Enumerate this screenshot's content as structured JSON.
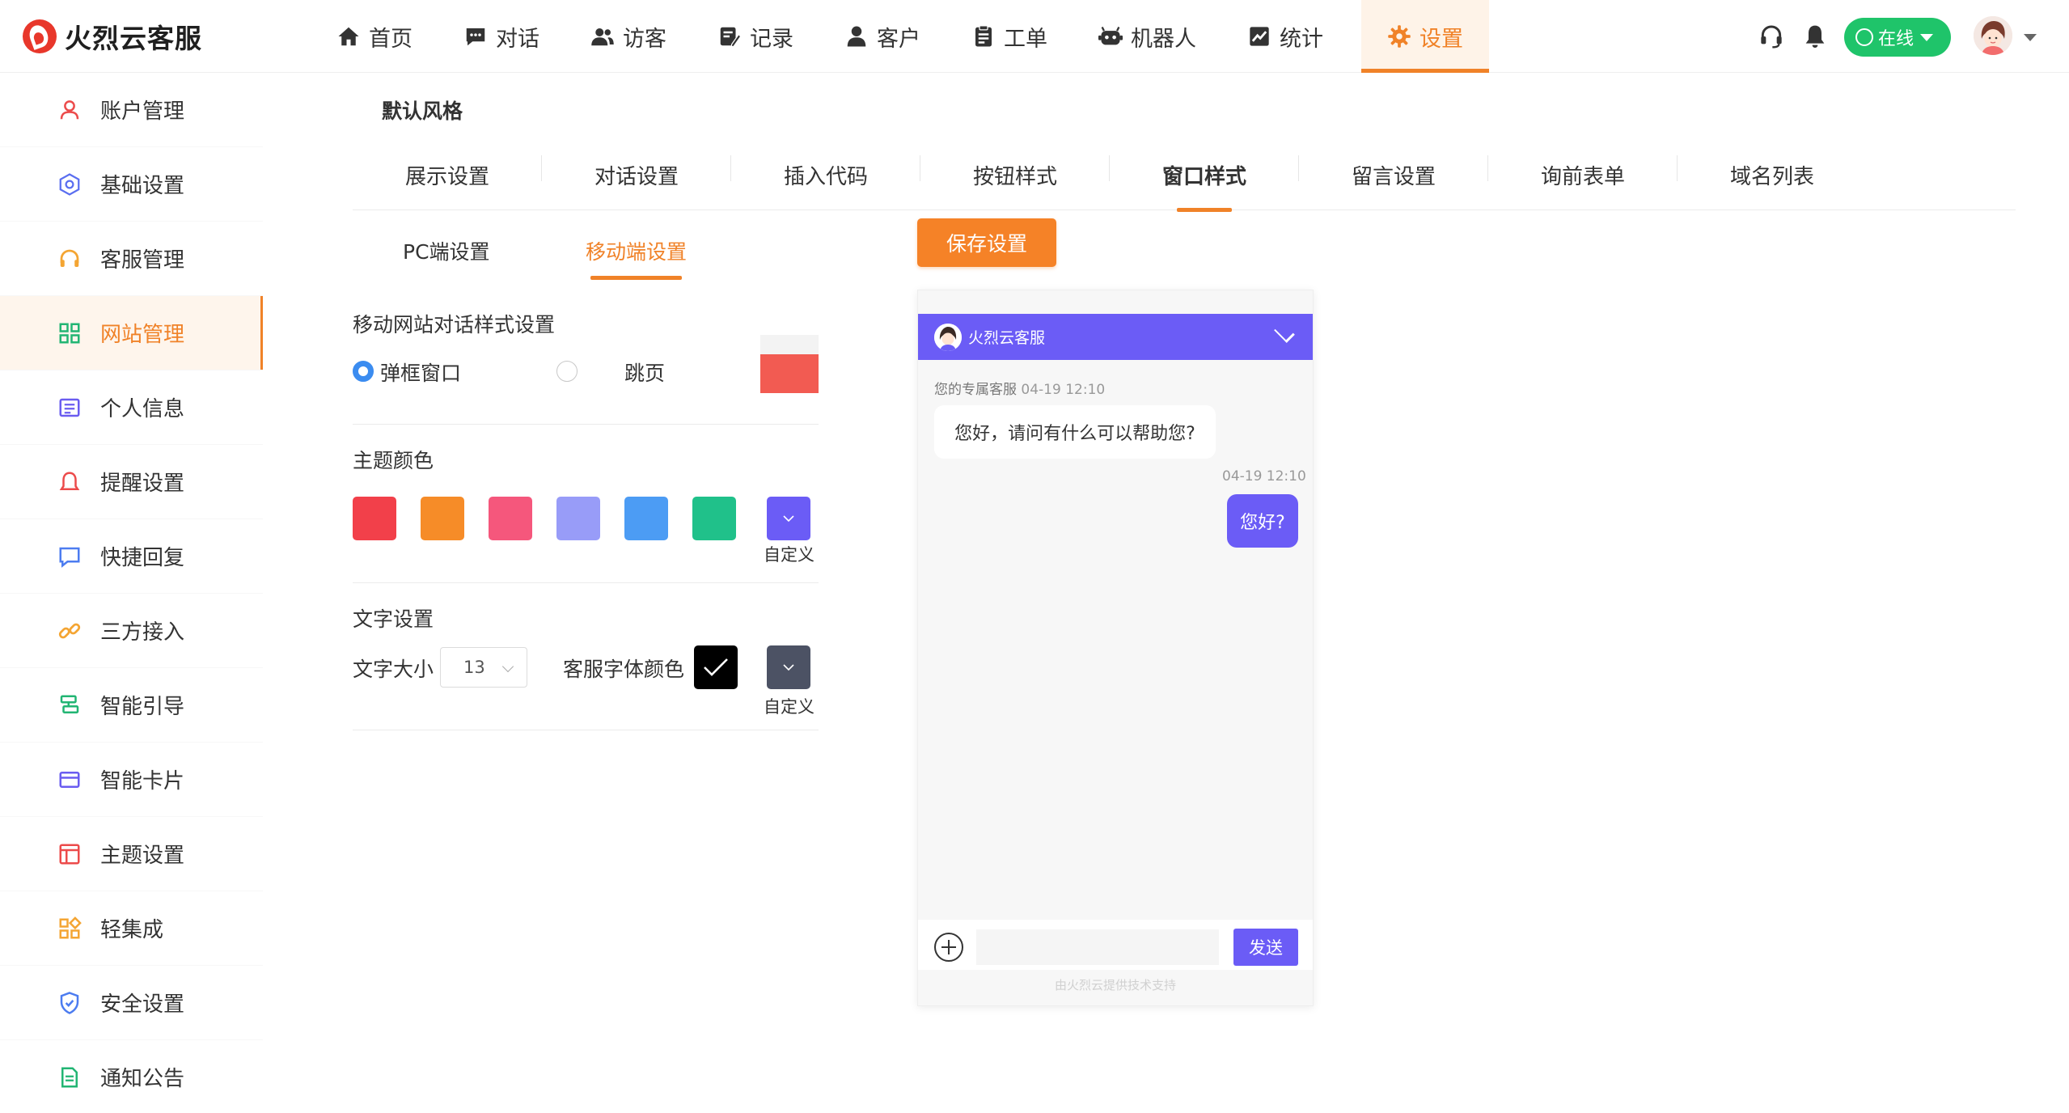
{
  "brand": {
    "name": "火烈云客服",
    "color": "#e8372b"
  },
  "nav": {
    "items": [
      {
        "label": "首页",
        "icon": "home-icon"
      },
      {
        "label": "对话",
        "icon": "chat-icon"
      },
      {
        "label": "访客",
        "icon": "visitors-icon"
      },
      {
        "label": "记录",
        "icon": "record-icon"
      },
      {
        "label": "客户",
        "icon": "customer-icon"
      },
      {
        "label": "工单",
        "icon": "ticket-icon"
      },
      {
        "label": "机器人",
        "icon": "robot-icon"
      },
      {
        "label": "统计",
        "icon": "stats-icon"
      },
      {
        "label": "设置",
        "icon": "gear-icon",
        "active": true
      }
    ],
    "accent": "#f08228"
  },
  "status": {
    "label": "在线",
    "color": "#1fc46a"
  },
  "sidebar": {
    "items": [
      {
        "label": "账户管理",
        "icon": "user-icon"
      },
      {
        "label": "基础设置",
        "icon": "hexagon-icon"
      },
      {
        "label": "客服管理",
        "icon": "headset-icon"
      },
      {
        "label": "网站管理",
        "icon": "grid-icon",
        "active": true
      },
      {
        "label": "个人信息",
        "icon": "profile-card-icon"
      },
      {
        "label": "提醒设置",
        "icon": "bell-icon"
      },
      {
        "label": "快捷回复",
        "icon": "message-icon"
      },
      {
        "label": "三方接入",
        "icon": "link-icon"
      },
      {
        "label": "智能引导",
        "icon": "guide-icon"
      },
      {
        "label": "智能卡片",
        "icon": "card-icon"
      },
      {
        "label": "主题设置",
        "icon": "theme-icon"
      },
      {
        "label": "轻集成",
        "icon": "integration-icon"
      },
      {
        "label": "安全设置",
        "icon": "shield-icon"
      },
      {
        "label": "通知公告",
        "icon": "notice-icon"
      }
    ]
  },
  "page": {
    "section_title": "默认风格",
    "tabs": [
      "展示设置",
      "对话设置",
      "插入代码",
      "按钮样式",
      "窗口样式",
      "留言设置",
      "询前表单",
      "域名列表"
    ],
    "active_tab": "窗口样式",
    "subtabs": [
      "PC端设置",
      "移动端设置"
    ],
    "active_subtab": "移动端设置",
    "save_label": "保存设置"
  },
  "settings": {
    "mobile_style_title": "移动网站对话样式设置",
    "mode_options": [
      "弹框窗口",
      "跳页"
    ],
    "selected_mode": "弹框窗口",
    "theme_title": "主题颜色",
    "theme_colors": [
      "#f2404a",
      "#f68c28",
      "#f5577c",
      "#989cf8",
      "#4c9cf4",
      "#20c18a"
    ],
    "custom_color": "#6b5cf6",
    "custom_label": "自定义",
    "text_title": "文字设置",
    "font_size_label": "文字大小",
    "font_size_value": "13",
    "agent_font_color_label": "客服字体颜色",
    "agent_font_color": "#000000",
    "agent_custom_color": "#4c5264",
    "agent_custom_label": "自定义"
  },
  "preview": {
    "header_title": "火烈云客服",
    "agent_meta_name": "您的专属客服",
    "agent_meta_time": "04-19 12:10",
    "agent_message": "您好，请问有什么可以帮助您?",
    "visitor_time": "04-19 12:10",
    "visitor_message": "您好?",
    "send_label": "发送",
    "powered_by": "由火烈云提供技术支持"
  }
}
